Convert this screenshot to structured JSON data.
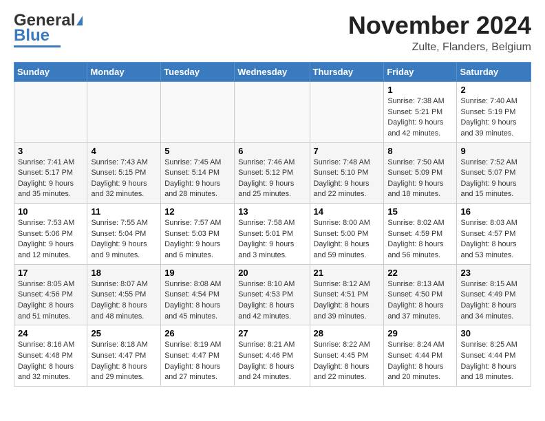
{
  "header": {
    "logo_general": "General",
    "logo_blue": "Blue",
    "month_title": "November 2024",
    "location": "Zulte, Flanders, Belgium"
  },
  "columns": [
    "Sunday",
    "Monday",
    "Tuesday",
    "Wednesday",
    "Thursday",
    "Friday",
    "Saturday"
  ],
  "weeks": [
    {
      "days": [
        {
          "num": "",
          "info": ""
        },
        {
          "num": "",
          "info": ""
        },
        {
          "num": "",
          "info": ""
        },
        {
          "num": "",
          "info": ""
        },
        {
          "num": "",
          "info": ""
        },
        {
          "num": "1",
          "info": "Sunrise: 7:38 AM\nSunset: 5:21 PM\nDaylight: 9 hours\nand 42 minutes."
        },
        {
          "num": "2",
          "info": "Sunrise: 7:40 AM\nSunset: 5:19 PM\nDaylight: 9 hours\nand 39 minutes."
        }
      ]
    },
    {
      "days": [
        {
          "num": "3",
          "info": "Sunrise: 7:41 AM\nSunset: 5:17 PM\nDaylight: 9 hours\nand 35 minutes."
        },
        {
          "num": "4",
          "info": "Sunrise: 7:43 AM\nSunset: 5:15 PM\nDaylight: 9 hours\nand 32 minutes."
        },
        {
          "num": "5",
          "info": "Sunrise: 7:45 AM\nSunset: 5:14 PM\nDaylight: 9 hours\nand 28 minutes."
        },
        {
          "num": "6",
          "info": "Sunrise: 7:46 AM\nSunset: 5:12 PM\nDaylight: 9 hours\nand 25 minutes."
        },
        {
          "num": "7",
          "info": "Sunrise: 7:48 AM\nSunset: 5:10 PM\nDaylight: 9 hours\nand 22 minutes."
        },
        {
          "num": "8",
          "info": "Sunrise: 7:50 AM\nSunset: 5:09 PM\nDaylight: 9 hours\nand 18 minutes."
        },
        {
          "num": "9",
          "info": "Sunrise: 7:52 AM\nSunset: 5:07 PM\nDaylight: 9 hours\nand 15 minutes."
        }
      ]
    },
    {
      "days": [
        {
          "num": "10",
          "info": "Sunrise: 7:53 AM\nSunset: 5:06 PM\nDaylight: 9 hours\nand 12 minutes."
        },
        {
          "num": "11",
          "info": "Sunrise: 7:55 AM\nSunset: 5:04 PM\nDaylight: 9 hours\nand 9 minutes."
        },
        {
          "num": "12",
          "info": "Sunrise: 7:57 AM\nSunset: 5:03 PM\nDaylight: 9 hours\nand 6 minutes."
        },
        {
          "num": "13",
          "info": "Sunrise: 7:58 AM\nSunset: 5:01 PM\nDaylight: 9 hours\nand 3 minutes."
        },
        {
          "num": "14",
          "info": "Sunrise: 8:00 AM\nSunset: 5:00 PM\nDaylight: 8 hours\nand 59 minutes."
        },
        {
          "num": "15",
          "info": "Sunrise: 8:02 AM\nSunset: 4:59 PM\nDaylight: 8 hours\nand 56 minutes."
        },
        {
          "num": "16",
          "info": "Sunrise: 8:03 AM\nSunset: 4:57 PM\nDaylight: 8 hours\nand 53 minutes."
        }
      ]
    },
    {
      "days": [
        {
          "num": "17",
          "info": "Sunrise: 8:05 AM\nSunset: 4:56 PM\nDaylight: 8 hours\nand 51 minutes."
        },
        {
          "num": "18",
          "info": "Sunrise: 8:07 AM\nSunset: 4:55 PM\nDaylight: 8 hours\nand 48 minutes."
        },
        {
          "num": "19",
          "info": "Sunrise: 8:08 AM\nSunset: 4:54 PM\nDaylight: 8 hours\nand 45 minutes."
        },
        {
          "num": "20",
          "info": "Sunrise: 8:10 AM\nSunset: 4:53 PM\nDaylight: 8 hours\nand 42 minutes."
        },
        {
          "num": "21",
          "info": "Sunrise: 8:12 AM\nSunset: 4:51 PM\nDaylight: 8 hours\nand 39 minutes."
        },
        {
          "num": "22",
          "info": "Sunrise: 8:13 AM\nSunset: 4:50 PM\nDaylight: 8 hours\nand 37 minutes."
        },
        {
          "num": "23",
          "info": "Sunrise: 8:15 AM\nSunset: 4:49 PM\nDaylight: 8 hours\nand 34 minutes."
        }
      ]
    },
    {
      "days": [
        {
          "num": "24",
          "info": "Sunrise: 8:16 AM\nSunset: 4:48 PM\nDaylight: 8 hours\nand 32 minutes."
        },
        {
          "num": "25",
          "info": "Sunrise: 8:18 AM\nSunset: 4:47 PM\nDaylight: 8 hours\nand 29 minutes."
        },
        {
          "num": "26",
          "info": "Sunrise: 8:19 AM\nSunset: 4:47 PM\nDaylight: 8 hours\nand 27 minutes."
        },
        {
          "num": "27",
          "info": "Sunrise: 8:21 AM\nSunset: 4:46 PM\nDaylight: 8 hours\nand 24 minutes."
        },
        {
          "num": "28",
          "info": "Sunrise: 8:22 AM\nSunset: 4:45 PM\nDaylight: 8 hours\nand 22 minutes."
        },
        {
          "num": "29",
          "info": "Sunrise: 8:24 AM\nSunset: 4:44 PM\nDaylight: 8 hours\nand 20 minutes."
        },
        {
          "num": "30",
          "info": "Sunrise: 8:25 AM\nSunset: 4:44 PM\nDaylight: 8 hours\nand 18 minutes."
        }
      ]
    }
  ]
}
